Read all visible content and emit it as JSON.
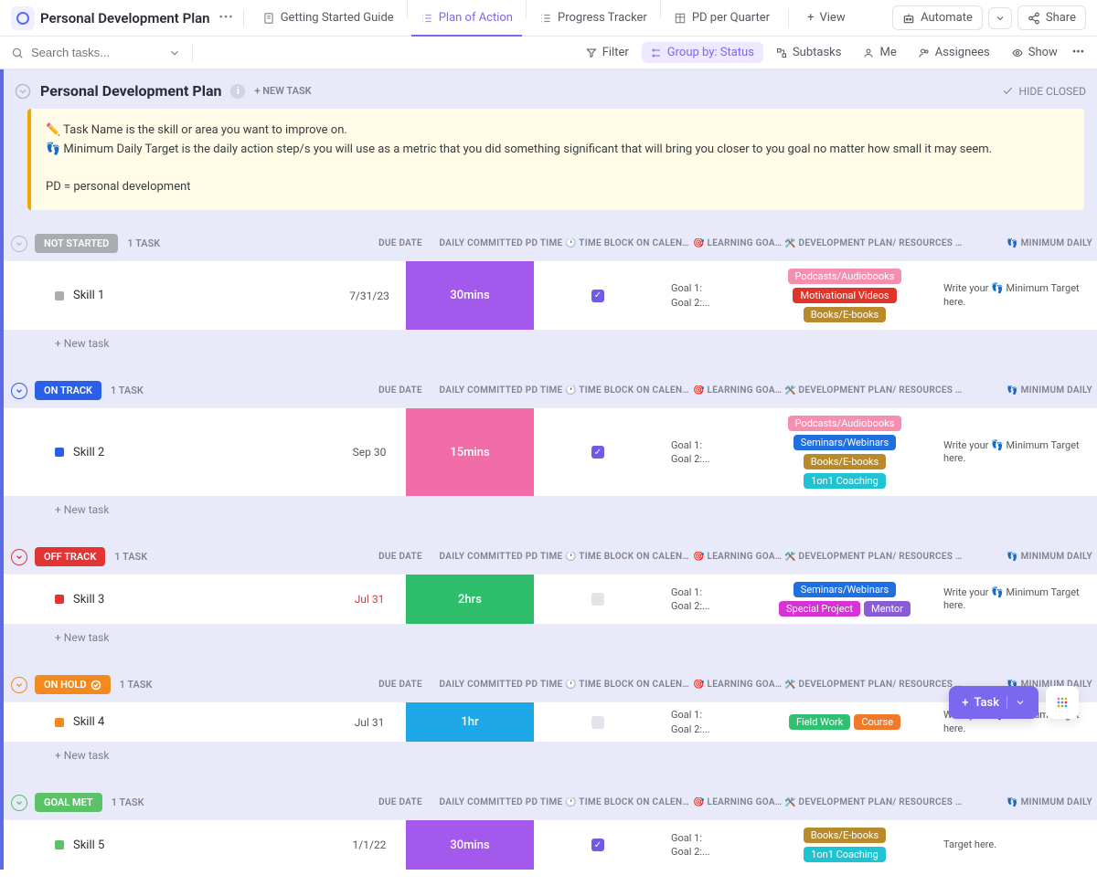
{
  "header": {
    "title": "Personal Development Plan",
    "tabs": [
      {
        "label": "Getting Started Guide",
        "icon": "doc-icon"
      },
      {
        "label": "Plan of Action",
        "icon": "list-icon",
        "active": true
      },
      {
        "label": "Progress Tracker",
        "icon": "list-icon"
      },
      {
        "label": "PD per Quarter",
        "icon": "table-icon"
      }
    ],
    "add_view": "View",
    "automate": "Automate",
    "share": "Share"
  },
  "toolbar": {
    "search_placeholder": "Search tasks...",
    "filter": "Filter",
    "group_by": "Group by: Status",
    "subtasks": "Subtasks",
    "me": "Me",
    "assignees": "Assignees",
    "show": "Show"
  },
  "list_header": {
    "title": "Personal Development Plan",
    "new_task": "+ NEW TASK",
    "hide_closed": "HIDE CLOSED"
  },
  "callout": {
    "line1": "✏️ Task Name is the skill or area you want to improve on.",
    "line2": "👣 Minimum Daily Target is the daily action step/s you will use as a metric that you did something significant that will bring you closer to you goal no matter how small it may seem.",
    "line3": "PD = personal development"
  },
  "columns": {
    "due_date": "DUE DATE",
    "committed": "DAILY COMMITTED PD TIME",
    "timeblock": "🕐 TIME BLOCK ON CALENDAR",
    "goals": "🎯 LEARNING GOAL/S",
    "resources": "🛠️ DEVELOPMENT PLAN/ RESOURCES NEEDED",
    "min_target": "👣 MINIMUM DAILY"
  },
  "tag_colors": {
    "Podcasts/Audiobooks": "#f58fb0",
    "Motivational Videos": "#e0342a",
    "Books/E-books": "#b88a2b",
    "Seminars/Webinars": "#1f6fe0",
    "1on1 Coaching": "#1fc3d1",
    "Special Project": "#d633d6",
    "Mentor": "#8a5bd6",
    "Field Work": "#2fc071",
    "Course": "#f07a2b"
  },
  "groups": [
    {
      "status": "NOT STARTED",
      "color": "#a9acb0",
      "chev": "#b8bcc7",
      "count": "1 TASK",
      "tasks": [
        {
          "name": "Skill 1",
          "sq": "#a9acb0",
          "due": "7/31/23",
          "due_color": "#54585f",
          "time": "30mins",
          "time_bg": "#a259ec",
          "checked": true,
          "goals": "Goal 1:\nGoal 2:...",
          "tags": [
            "Podcasts/Audiobooks",
            "Motivational Videos",
            "Books/E-books"
          ],
          "min": "Write your 👣 Minimum Target here."
        }
      ],
      "new_task": "+ New task"
    },
    {
      "status": "ON TRACK",
      "color": "#2a5fe8",
      "chev": "#2a5fe8",
      "count": "1 TASK",
      "tasks": [
        {
          "name": "Skill 2",
          "sq": "#2a5fe8",
          "due": "Sep 30",
          "due_color": "#54585f",
          "time": "15mins",
          "time_bg": "#f26ca7",
          "checked": true,
          "goals": "Goal 1:\nGoal 2:...",
          "tags": [
            "Podcasts/Audiobooks",
            "Seminars/Webinars",
            "Books/E-books",
            "1on1 Coaching"
          ],
          "min": "Write your 👣 Minimum Target here."
        }
      ],
      "new_task": "+ New task"
    },
    {
      "status": "OFF TRACK",
      "color": "#e23434",
      "chev": "#e23434",
      "count": "1 TASK",
      "tasks": [
        {
          "name": "Skill 3",
          "sq": "#e23434",
          "due": "Jul 31",
          "due_color": "#e23434",
          "time": "2hrs",
          "time_bg": "#2ebd6b",
          "checked": false,
          "goals": "Goal 1:\nGoal 2:...",
          "tags": [
            "Seminars/Webinars",
            "Special Project",
            "Mentor"
          ],
          "min": "Write your 👣 Minimum Target here."
        }
      ],
      "new_task": "+ New task"
    },
    {
      "status": "ON HOLD",
      "color": "#f28a1f",
      "chev": "#f28a1f",
      "count": "1 TASK",
      "badge": true,
      "tasks": [
        {
          "name": "Skill 4",
          "sq": "#f28a1f",
          "due": "Jul 31",
          "due_color": "#54585f",
          "time": "1hr",
          "time_bg": "#1fa8e8",
          "checked": false,
          "goals": "Goal 1:\nGoal 2:...",
          "tags": [
            "Field Work",
            "Course"
          ],
          "min": "Write your 👣 Minimum Target here."
        }
      ],
      "new_task": "+ New task"
    },
    {
      "status": "GOAL MET",
      "color": "#5bc26a",
      "chev": "#5bc26a",
      "count": "1 TASK",
      "tasks": [
        {
          "name": "Skill 5",
          "sq": "#5bc26a",
          "due": "1/1/22",
          "due_color": "#54585f",
          "time": "30mins",
          "time_bg": "#a259ec",
          "checked": true,
          "goals": "Goal 1:\nGoal 2:...",
          "tags": [
            "Books/E-books",
            "1on1 Coaching"
          ],
          "min": "Target here."
        }
      ]
    }
  ],
  "fab": {
    "task": "Task"
  }
}
